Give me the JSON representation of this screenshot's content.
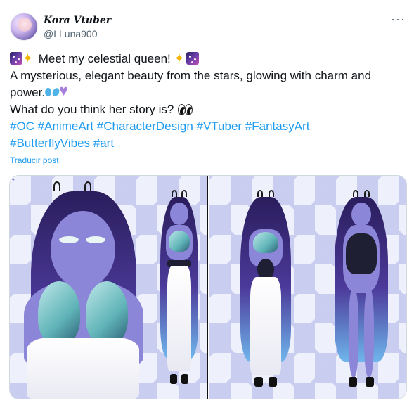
{
  "author": {
    "display_name": "Kora Vtuber",
    "handle": "@LLuna900"
  },
  "menu": {
    "more_label": "···"
  },
  "tweet": {
    "line1_text": " Meet my celestial queen! ",
    "line2_text": "A mysterious, elegant beauty from the stars, glowing with charm and",
    "line3_text": "power.",
    "line4_text": "What do you think her story is? ",
    "hashtags_line1": "#OC #AnimeArt #CharacterDesign #VTuber #FantasyArt",
    "hashtags_line2": "#ButterflyVibes #art",
    "emoji_icons": [
      "milky-way-icon",
      "sparkles-icon",
      "butterfly-icon",
      "purple-heart-icon",
      "eyes-icon"
    ]
  },
  "translate_label": "Traducir post",
  "media": {
    "panels": [
      {
        "name": "portrait-closeup"
      },
      {
        "name": "front-back-reference"
      }
    ],
    "colors": {
      "diamond_light": "#eef0fb",
      "diamond_dark": "#c9cdf0",
      "skin": "#8b86d8",
      "hair": "#2a1d5c",
      "wing": "#5fb3b7"
    }
  },
  "colors": {
    "link": "#1d9bf0",
    "muted": "#536471",
    "text": "#0f1419"
  }
}
